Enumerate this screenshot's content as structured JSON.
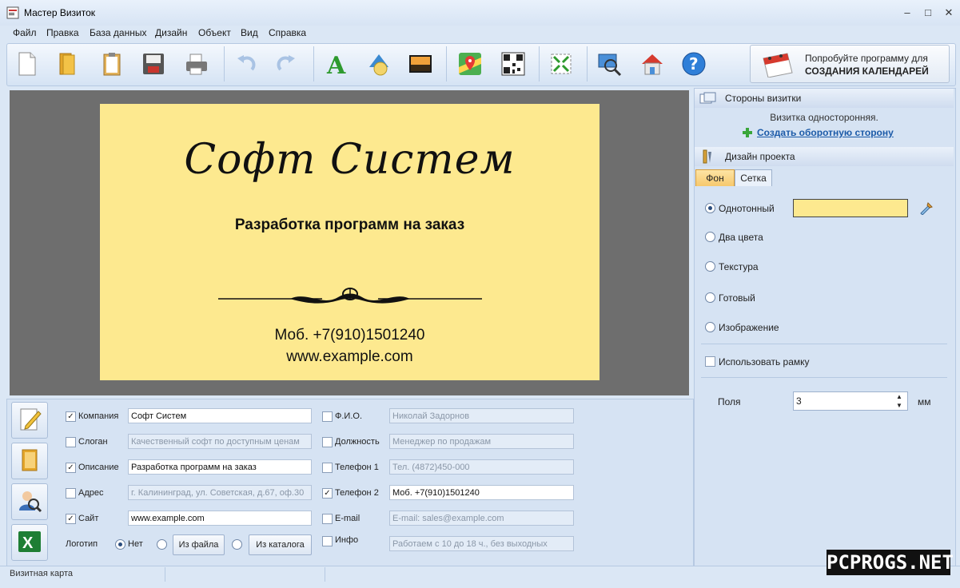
{
  "window": {
    "title": "Мастер Визиток",
    "minimize": "‒",
    "maximize": "□",
    "close": "✕"
  },
  "menu": [
    "Файл",
    "Правка",
    "База данных",
    "Дизайн",
    "Объект",
    "Вид",
    "Справка"
  ],
  "toolbar": {
    "buttons": [
      "new-file-icon",
      "open-folder-icon",
      "clipboard-icon",
      "save-icon",
      "print-icon",
      "undo-icon",
      "redo-icon",
      "text-icon",
      "shapes-icon",
      "image-icon",
      "map-icon",
      "qr-code-icon",
      "fit-page-icon",
      "preview-icon",
      "home-icon",
      "help-icon"
    ],
    "promo_line1": "Попробуйте программу для",
    "promo_line2": "СОЗДАНИЯ КАЛЕНДАРЕЙ"
  },
  "card": {
    "company": "Софт Систем",
    "description": "Разработка программ на заказ",
    "phone": "Моб. +7(910)1501240",
    "site": "www.example.com",
    "background": "#fde98f"
  },
  "fields_left": [
    {
      "label": "Компания",
      "checked": true,
      "value": "Софт Систем"
    },
    {
      "label": "Слоган",
      "checked": false,
      "value": "Качественный софт по доступным ценам"
    },
    {
      "label": "Описание",
      "checked": true,
      "value": "Разработка программ на заказ"
    },
    {
      "label": "Адрес",
      "checked": false,
      "value": "г. Калининград, ул. Советская, д.67, оф.30"
    },
    {
      "label": "Сайт",
      "checked": true,
      "value": "www.example.com"
    }
  ],
  "fields_right": [
    {
      "label": "Ф.И.О.",
      "checked": false,
      "value": "Николай Задорнов"
    },
    {
      "label": "Должность",
      "checked": false,
      "value": "Менеджер по продажам"
    },
    {
      "label": "Телефон 1",
      "checked": false,
      "value": "Тел. (4872)450-000"
    },
    {
      "label": "Телефон 2",
      "checked": true,
      "value": "Моб. +7(910)1501240"
    },
    {
      "label": "E-mail",
      "checked": false,
      "value": "E-mail: sales@example.com"
    },
    {
      "label": "Инфо",
      "checked": false,
      "value": "Работаем с 10 до 18 ч., без выходных"
    }
  ],
  "logo": {
    "label": "Логотип",
    "none": "Нет",
    "from_file": "Из файла",
    "from_catalog": "Из каталога"
  },
  "side_buttons": [
    "edit-card-icon",
    "contacts-book-icon",
    "user-search-icon",
    "excel-icon"
  ],
  "sides_panel": {
    "title": "Стороны визитки",
    "info": "Визитка односторонняя.",
    "link": "Создать оборотную сторону"
  },
  "design_panel": {
    "title": "Дизайн проекта",
    "tabs": [
      "Фон",
      "Сетка"
    ],
    "options": [
      "Однотонный",
      "Два цвета",
      "Текстура",
      "Готовый",
      "Изображение"
    ],
    "selected_option": "Однотонный",
    "color": "#fde98f",
    "frame_label": "Использовать рамку",
    "margins_label": "Поля",
    "margins_value": "3",
    "margins_unit": "мм"
  },
  "status": {
    "text": "Визитная карта"
  },
  "watermark": "PCPROGS.NET"
}
